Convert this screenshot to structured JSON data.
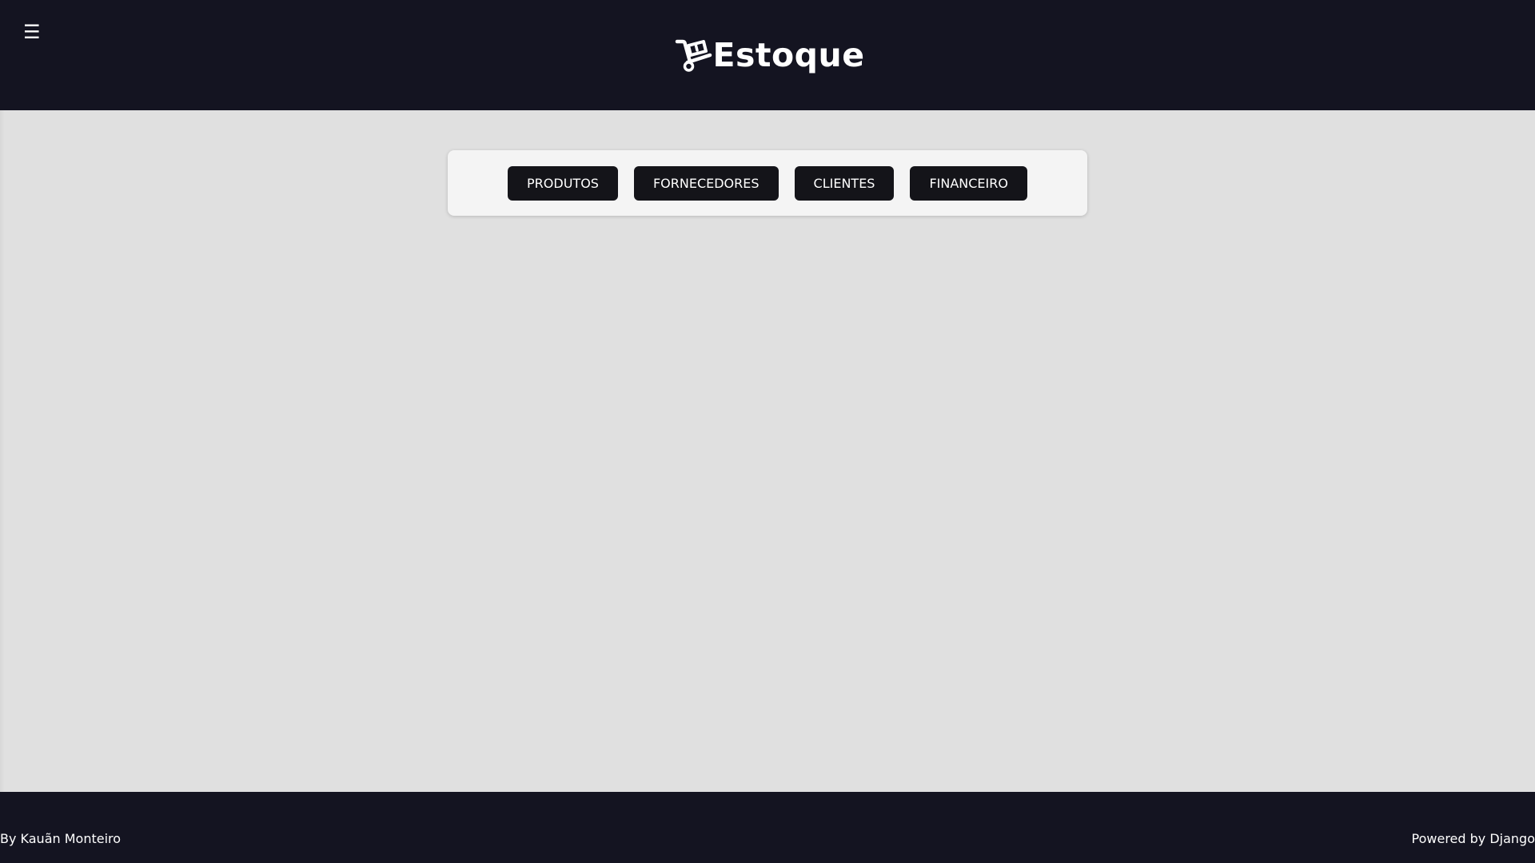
{
  "header": {
    "menu_icon": "☰",
    "logo_icon": "dolly-cart-icon",
    "title": "Estoque"
  },
  "nav": {
    "buttons": [
      {
        "label": "PRODUTOS"
      },
      {
        "label": "FORNECEDORES"
      },
      {
        "label": "CLIENTES"
      },
      {
        "label": "FINANCEIRO"
      }
    ]
  },
  "footer": {
    "author": "By Kauãn Monteiro",
    "powered": "Powered by Django"
  },
  "colors": {
    "header_bg": "#141421",
    "page_bg": "#e0e0e0",
    "card_bg": "#f4f4f4",
    "button_bg": "#141419",
    "text_light": "#ffffff"
  }
}
